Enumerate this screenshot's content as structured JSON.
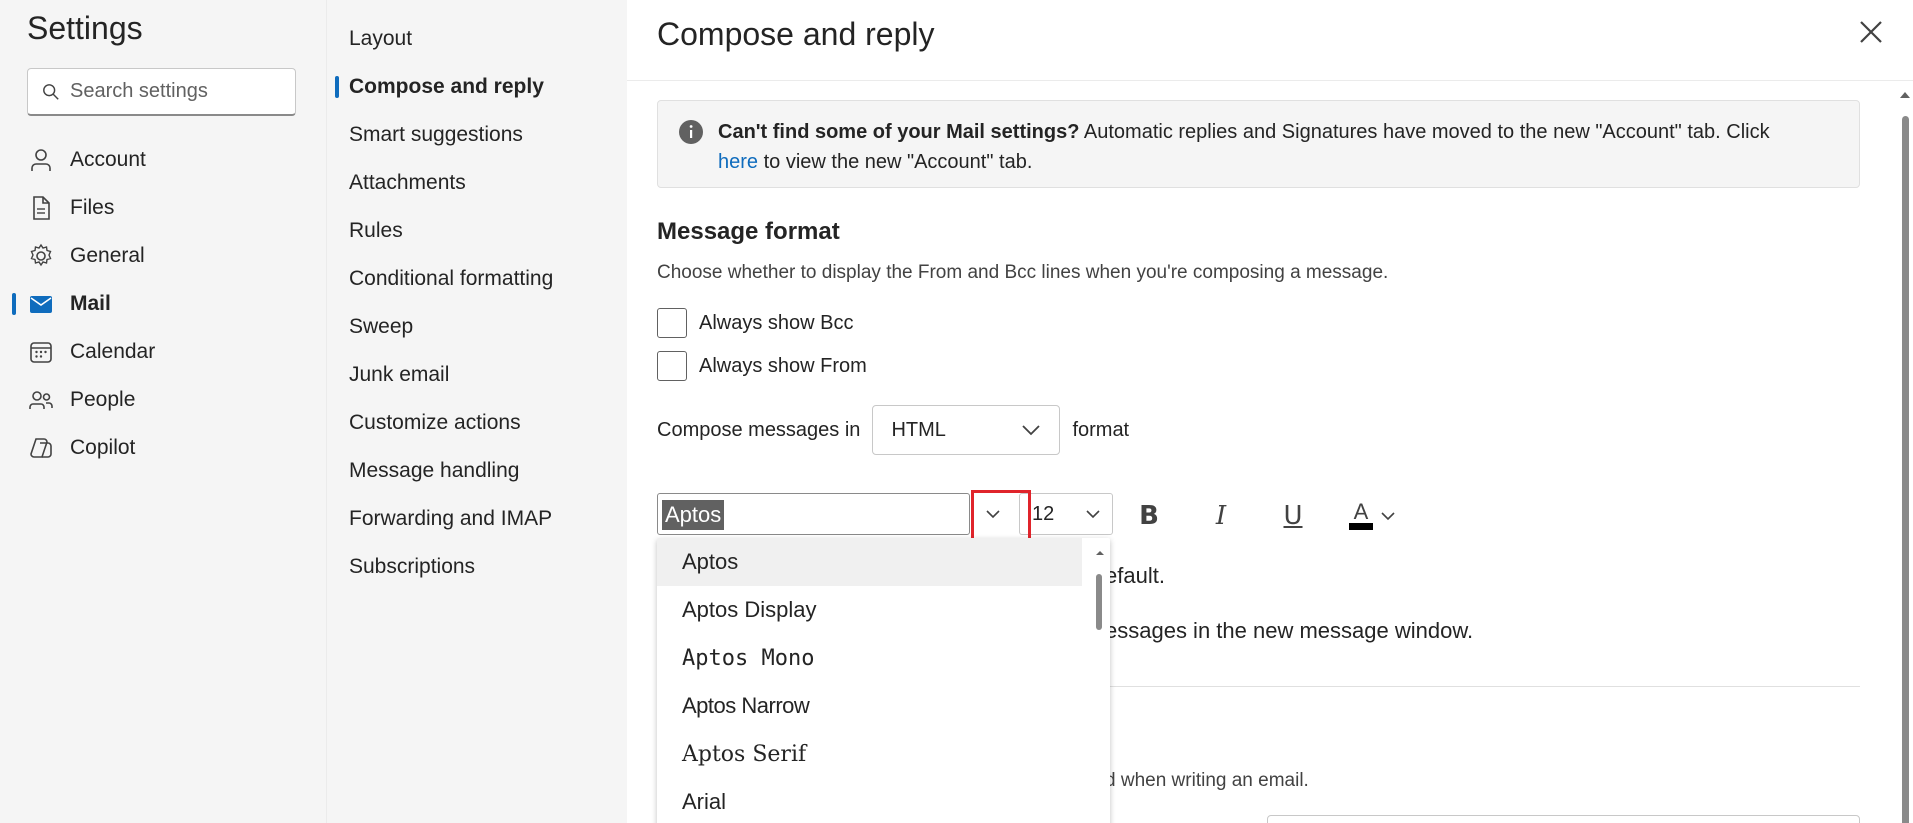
{
  "left_nav": {
    "title": "Settings",
    "search_placeholder": "Search settings",
    "items": [
      {
        "label": "Account",
        "icon": "person-icon"
      },
      {
        "label": "Files",
        "icon": "document-icon"
      },
      {
        "label": "General",
        "icon": "gear-icon"
      },
      {
        "label": "Mail",
        "icon": "mail-icon",
        "active": true
      },
      {
        "label": "Calendar",
        "icon": "calendar-icon"
      },
      {
        "label": "People",
        "icon": "people-icon"
      },
      {
        "label": "Copilot",
        "icon": "copilot-icon"
      }
    ]
  },
  "sub_nav": {
    "items": [
      {
        "label": "Layout"
      },
      {
        "label": "Compose and reply",
        "active": true
      },
      {
        "label": "Smart suggestions"
      },
      {
        "label": "Attachments"
      },
      {
        "label": "Rules"
      },
      {
        "label": "Conditional formatting"
      },
      {
        "label": "Sweep"
      },
      {
        "label": "Junk email"
      },
      {
        "label": "Customize actions"
      },
      {
        "label": "Message handling"
      },
      {
        "label": "Forwarding and IMAP"
      },
      {
        "label": "Subscriptions"
      }
    ]
  },
  "main": {
    "title": "Compose and reply",
    "banner": {
      "bold": "Can't find some of your Mail settings?",
      "text1": " Automatic replies and Signatures have moved to the new \"Account\" tab. Click",
      "link": "here",
      "text2": " to view the new \"Account\" tab."
    },
    "message_format": {
      "heading": "Message format",
      "description": "Choose whether to display the From and Bcc lines when you're composing a message.",
      "always_show_bcc": "Always show Bcc",
      "always_show_from": "Always show From",
      "compose_prefix": "Compose messages in",
      "compose_value": "HTML",
      "compose_suffix": "format"
    },
    "toolbar": {
      "font_value": "Aptos",
      "size_value": "12",
      "bold": "B",
      "italic": "I",
      "underline": "U",
      "font_color": "A"
    },
    "partial_text_1": "efault.",
    "partial_text_2": "essages in the new message window.",
    "partial_text_3": "d when writing an email."
  },
  "font_dropdown": {
    "options": [
      "Aptos",
      "Aptos Display",
      "Aptos Mono",
      "Aptos Narrow",
      "Aptos Serif",
      "Arial"
    ],
    "highlighted": "Aptos"
  },
  "colors": {
    "accent": "#0f6cbd",
    "highlight_box": "#e0242b"
  }
}
